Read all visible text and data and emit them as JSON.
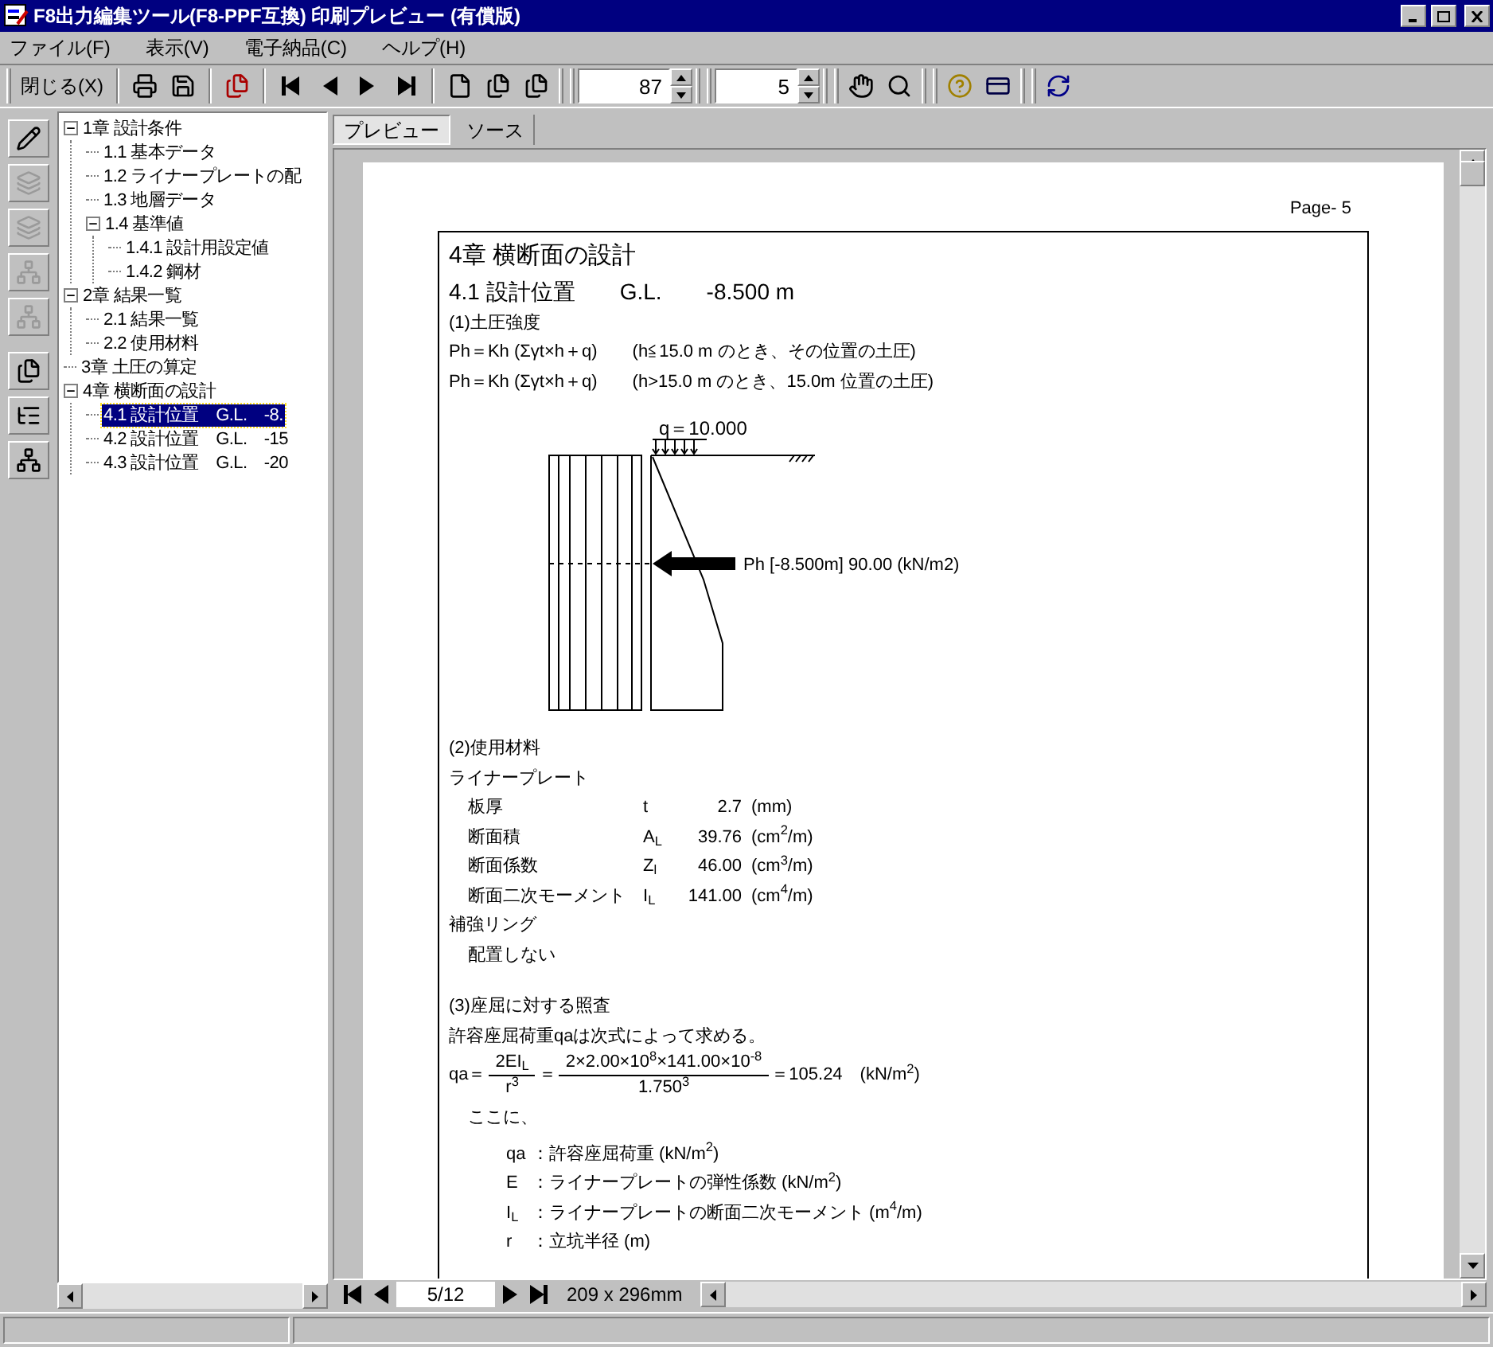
{
  "window": {
    "title": "F8出力編集ツール(F8-PPF互換) 印刷プレビュー (有償版)"
  },
  "menu": [
    "ファイル(F)",
    "表示(V)",
    "電子納品(C)",
    "ヘルプ(H)"
  ],
  "toolbar": {
    "close_label": "閉じる(X)",
    "zoom": "87",
    "page": "5"
  },
  "side_tools": [
    {
      "disabled": false
    },
    {
      "disabled": true
    },
    {
      "disabled": true
    },
    {
      "disabled": true
    },
    {
      "disabled": true
    },
    {
      "disabled": false
    },
    {
      "disabled": false
    },
    {
      "disabled": false
    }
  ],
  "tree": [
    {
      "label": "1章 設計条件",
      "expanded": true,
      "selected": false,
      "children": [
        {
          "label": "1.1 基本データ",
          "selected": false
        },
        {
          "label": "1.2 ライナープレートの配",
          "selected": false
        },
        {
          "label": "1.3 地層データ",
          "selected": false
        },
        {
          "label": "1.4 基準値",
          "expanded": true,
          "selected": false,
          "children": [
            {
              "label": "1.4.1 設計用設定値",
              "selected": false
            },
            {
              "label": "1.4.2 鋼材",
              "selected": false
            }
          ]
        }
      ]
    },
    {
      "label": "2章 結果一覧",
      "expanded": true,
      "selected": false,
      "children": [
        {
          "label": "2.1 結果一覧",
          "selected": false
        },
        {
          "label": "2.2 使用材料",
          "selected": false
        }
      ]
    },
    {
      "label": "3章 土圧の算定",
      "selected": false
    },
    {
      "label": "4章 横断面の設計",
      "expanded": true,
      "selected": false,
      "children": [
        {
          "label": "4.1 設計位置　G.L.　-8.",
          "selected": true
        },
        {
          "label": "4.2 設計位置　G.L.　-15",
          "selected": false
        },
        {
          "label": "4.3 設計位置　G.L.　-20",
          "selected": false
        }
      ]
    }
  ],
  "tabs": [
    {
      "label": "プレビュー",
      "selected": true
    },
    {
      "label": "ソース",
      "selected": false
    }
  ],
  "page": {
    "page_label": "Page- 5",
    "chapter": "4章 横断面の設計",
    "section": "4.1 設計位置　　G.L.　　-8.500 m",
    "earth_pressure": {
      "heading": "(1)土圧強度",
      "lines": [
        "Ph＝Kh (Σγt×h＋q)　　(h≦15.0 m のとき、その位置の土圧)",
        "Ph＝Kh (Σγt×h＋q)　　(h>15.0 m のとき、15.0m 位置の土圧)"
      ]
    },
    "diagram": {
      "load_label": "q＝10.000",
      "pressure_label": "Ph [-8.500m] 90.00 (kN/m2)"
    },
    "materials": {
      "heading": "(2)使用材料",
      "subheading": "ライナープレート",
      "rows": [
        {
          "name": "板厚",
          "symbol": "t",
          "value": "2.7",
          "unit": "(mm)"
        },
        {
          "name": "断面積",
          "symbol": "A$_{L}$",
          "value": "39.76",
          "unit": "(cm$^{2}$/m)"
        },
        {
          "name": "断面係数",
          "symbol": "Z$_{l}$",
          "value": "46.00",
          "unit": "(cm$^{3}$/m)"
        },
        {
          "name": "断面二次モーメント",
          "symbol": "I$_{L}$",
          "value": "141.00",
          "unit": "(cm$^{4}$/m)"
        }
      ],
      "ring_heading": "補強リング",
      "ring_value": "配置しない"
    },
    "buckling": {
      "heading": "(3)座屈に対する照査",
      "intro": "許容座屈荷重qaは次式によって求める。",
      "lhs": "qa＝",
      "frac1_top": "2EI$_{L}$",
      "frac1_bottom": "r$^{3}$",
      "eq": "＝",
      "frac2_top": "2×2.00×10$^{8}$×141.00×10$^{-8}$",
      "frac2_bottom": "1.750$^{3}$",
      "result": "＝105.24　(kN/m$^{2}$)",
      "note": "ここに、",
      "definitions": [
        {
          "symbol": "qa",
          "text": "：許容座屈荷重 (kN/m$^{2}$)"
        },
        {
          "symbol": "E",
          "text": "：ライナープレートの弾性係数 (kN/m$^{2}$)"
        },
        {
          "symbol": "I$_{L}$",
          "text": "：ライナープレートの断面二次モーメント (m$^{4}$/m)"
        },
        {
          "symbol": "r",
          "text": "：立坑半径 (m)"
        }
      ]
    }
  },
  "nav": {
    "page": "5/12",
    "size": "209 x 296mm"
  }
}
